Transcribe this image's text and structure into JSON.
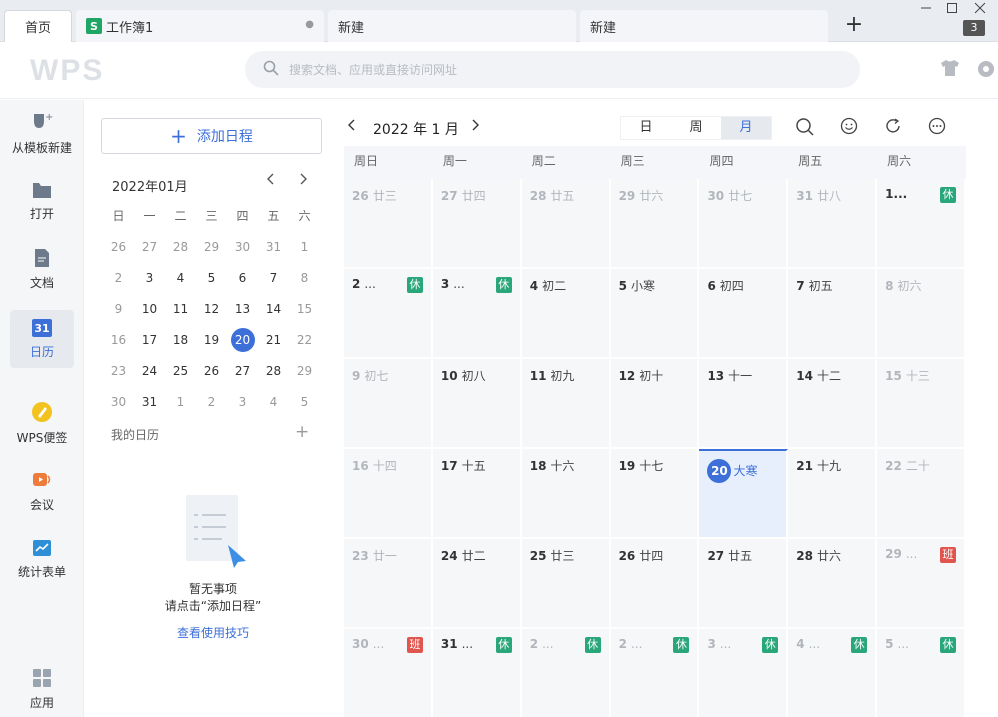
{
  "tabs": {
    "home": "首页",
    "sheet": "工作簿1",
    "sheet_icon": "S",
    "new1": "新建",
    "new2": "新建",
    "add": "+",
    "count_badge": "3"
  },
  "header": {
    "logo": "WPS",
    "search_placeholder": "搜索文档、应用或直接访问网址"
  },
  "nav": {
    "template": "从模板新建",
    "open": "打开",
    "docs": "文档",
    "calendar": "日历",
    "calendar_icon_text": "31",
    "notes": "WPS便签",
    "meeting": "会议",
    "forms": "统计表单",
    "apps": "应用"
  },
  "panel": {
    "add_label": "添加日程",
    "month_title": "2022年01月",
    "weekdays": [
      "日",
      "一",
      "二",
      "三",
      "四",
      "五",
      "六"
    ],
    "weeks": [
      [
        "26",
        "27",
        "28",
        "29",
        "30",
        "31",
        "1"
      ],
      [
        "2",
        "3",
        "4",
        "5",
        "6",
        "7",
        "8"
      ],
      [
        "9",
        "10",
        "11",
        "12",
        "13",
        "14",
        "15"
      ],
      [
        "16",
        "17",
        "18",
        "19",
        "20",
        "21",
        "22"
      ],
      [
        "23",
        "24",
        "25",
        "26",
        "27",
        "28",
        "29"
      ],
      [
        "30",
        "31",
        "1",
        "2",
        "3",
        "4",
        "5"
      ]
    ],
    "selected": "20",
    "my_calendar": "我的日历",
    "my_calendar_add": "+",
    "empty_line1": "暂无事项",
    "empty_line2": "请点击“添加日程”",
    "tips_link": "查看使用技巧"
  },
  "calendar": {
    "title": "2022 年 1 月",
    "views": [
      "日",
      "周",
      "月"
    ],
    "active_view": "月",
    "weekday_headers": [
      "周日",
      "周一",
      "周二",
      "周三",
      "周四",
      "周五",
      "周六"
    ],
    "weeks": [
      [
        {
          "num": "26",
          "lunar": "廿三",
          "dim": true
        },
        {
          "num": "27",
          "lunar": "廿四",
          "dim": true
        },
        {
          "num": "28",
          "lunar": "廿五",
          "dim": true
        },
        {
          "num": "29",
          "lunar": "廿六",
          "dim": true
        },
        {
          "num": "30",
          "lunar": "廿七",
          "dim": true
        },
        {
          "num": "31",
          "lunar": "廿八",
          "dim": true
        },
        {
          "num": "1...",
          "lunar": "",
          "tag": "休"
        }
      ],
      [
        {
          "num": "2",
          "lunar": "...",
          "tag": "休"
        },
        {
          "num": "3",
          "lunar": "...",
          "tag": "休"
        },
        {
          "num": "4",
          "lunar": "初二"
        },
        {
          "num": "5",
          "lunar": "小寒"
        },
        {
          "num": "6",
          "lunar": "初四"
        },
        {
          "num": "7",
          "lunar": "初五"
        },
        {
          "num": "8",
          "lunar": "初六",
          "dim": true
        }
      ],
      [
        {
          "num": "9",
          "lunar": "初七",
          "dim": true
        },
        {
          "num": "10",
          "lunar": "初八"
        },
        {
          "num": "11",
          "lunar": "初九"
        },
        {
          "num": "12",
          "lunar": "初十"
        },
        {
          "num": "13",
          "lunar": "十一"
        },
        {
          "num": "14",
          "lunar": "十二"
        },
        {
          "num": "15",
          "lunar": "十三",
          "dim": true
        }
      ],
      [
        {
          "num": "16",
          "lunar": "十四",
          "dim": true
        },
        {
          "num": "17",
          "lunar": "十五"
        },
        {
          "num": "18",
          "lunar": "十六"
        },
        {
          "num": "19",
          "lunar": "十七"
        },
        {
          "num": "20",
          "lunar": "大寒",
          "today": true
        },
        {
          "num": "21",
          "lunar": "十九"
        },
        {
          "num": "22",
          "lunar": "二十",
          "dim": true
        }
      ],
      [
        {
          "num": "23",
          "lunar": "廿一",
          "dim": true
        },
        {
          "num": "24",
          "lunar": "廿二"
        },
        {
          "num": "25",
          "lunar": "廿三"
        },
        {
          "num": "26",
          "lunar": "廿四"
        },
        {
          "num": "27",
          "lunar": "廿五"
        },
        {
          "num": "28",
          "lunar": "廿六"
        },
        {
          "num": "29",
          "lunar": "...",
          "dim": true,
          "tag": "班"
        }
      ],
      [
        {
          "num": "30",
          "lunar": "...",
          "dim": true,
          "tag": "班"
        },
        {
          "num": "31",
          "lunar": "...",
          "tag": "休"
        },
        {
          "num": "2",
          "lunar": "...",
          "dim": true,
          "tag": "休"
        },
        {
          "num": "2",
          "lunar": "...",
          "dim": true,
          "tag": "休"
        },
        {
          "num": "3",
          "lunar": "...",
          "dim": true,
          "tag": "休"
        },
        {
          "num": "4",
          "lunar": "...",
          "dim": true,
          "tag": "休"
        },
        {
          "num": "5",
          "lunar": "...",
          "dim": true,
          "tag": "休"
        }
      ]
    ]
  },
  "colors": {
    "accent": "#3c6fd8",
    "rest_tag": "#2aa67b",
    "work_tag": "#e0564f"
  }
}
